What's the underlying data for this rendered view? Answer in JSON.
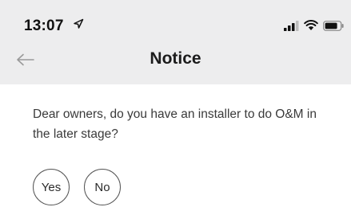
{
  "status_bar": {
    "time": "13:07",
    "icons": [
      "location-arrow-icon",
      "cellular-signal-icon",
      "wifi-icon",
      "battery-icon"
    ]
  },
  "header": {
    "back_icon": "back-arrow-icon",
    "title": "Notice"
  },
  "main": {
    "question": "Dear owners, do you have an installer to do O&M in the later stage?",
    "answers": {
      "yes_label": "Yes",
      "no_label": "No"
    }
  },
  "colors": {
    "header_bg": "#ededee",
    "page_bg": "#ffffff",
    "text": "#3a3a3a"
  }
}
